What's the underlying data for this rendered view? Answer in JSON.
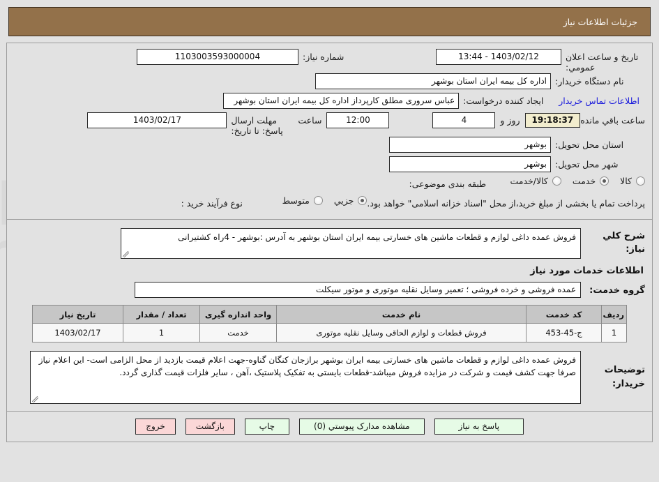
{
  "header": {
    "title": "جزئیات اطلاعات نیاز",
    "bar_color": "#93714a"
  },
  "form": {
    "need_number_label": "شماره نیاز:",
    "need_number_value": "1103003593000004",
    "public_announce_label": "تاریخ و ساعت اعلان عمومي:",
    "public_announce_value": "1403/02/12 - 13:44",
    "buyer_org_label": "نام دستگاه خریدار:",
    "buyer_org_value": "اداره کل بیمه ایران استان بوشهر",
    "creator_label": "ایجاد کننده درخواست:",
    "creator_value": "عباس سروری مطلق کارپرداز اداره کل بیمه ایران استان بوشهر",
    "contact_link": "اطلاعات تماس خریدار",
    "deadline_label": "مهلت ارسال پاسخ: تا تاریخ:",
    "deadline_date": "1403/02/17",
    "deadline_hour_label": "ساعت",
    "deadline_hour": "12:00",
    "days_value": "4",
    "days_word": "روز و",
    "countdown": "19:18:37",
    "remaining_word": "ساعت باقي مانده",
    "province_label": "استان محل تحویل:",
    "province_value": "بوشهر",
    "city_label": "شهر محل تحویل:",
    "city_value": "بوشهر",
    "category_label": "طبقه بندی موضوعی:",
    "category_options": [
      {
        "label": "کالا",
        "selected": false
      },
      {
        "label": "خدمت",
        "selected": true
      },
      {
        "label": "کالا/خدمت",
        "selected": false
      }
    ],
    "process_label": "نوع فرآیند خرید :",
    "process_options": [
      {
        "label": "جزیي",
        "selected": true
      },
      {
        "label": "متوسط",
        "selected": false
      }
    ],
    "payment_note": "پرداخت تمام یا بخشی از مبلغ خرید،از محل \"اسناد خزانه اسلامی\" خواهد بود."
  },
  "detail": {
    "need_desc_label": "شرح کلي نیاز:",
    "need_desc_value": "فروش عمده داغی لوازم و قطعات ماشین های خسارتی بیمه ایران استان بوشهر به  آدرس :بوشهر - 4راه کشتیرانی",
    "services_section_title": "اطلاعات خدمات مورد نیاز",
    "service_group_label": "گروه خدمت:",
    "service_group_value": "عمده فروشی و خرده فروشی ؛ تعمیر وسایل نقلیه موتوری و موتور سیکلت"
  },
  "table": {
    "headers": [
      "ردیف",
      "کد خدمت",
      "نام خدمت",
      "واحد اندازه گیری",
      "تعداد / مقدار",
      "تاریخ نیاز"
    ],
    "rows": [
      {
        "radif": "1",
        "code": "ج-45-453",
        "name": "فروش قطعات و لوازم الحاقی وسایل نقلیه موتوری",
        "unit": "خدمت",
        "qty": "1",
        "date": "1403/02/17"
      }
    ]
  },
  "buyer_notes": {
    "label": "توضیحات خریدار:",
    "value": "فروش عمده داغی لوازم و قطعات ماشین های خسارتی بیمه ایران بوشهر برازجان کنگان گناوه-جهت اعلام قیمت بازدید از محل الزامی است- این اعلام نیاز صرفا جهت کشف قیمت و شرکت در مزایده فروش میباشد-قطعات بایستی به تفکیک پلاستیک ،آهن ، سایر فلزات قیمت گذاری گردد."
  },
  "footer": {
    "buttons": [
      {
        "label": "پاسخ به نیاز",
        "style": "green"
      },
      {
        "label": "مشاهده مدارک پیوستي (0)",
        "style": "green"
      },
      {
        "label": "چاپ",
        "style": "green"
      },
      {
        "label": "بازگشت",
        "style": "pink"
      },
      {
        "label": "خروج",
        "style": "pink"
      }
    ]
  },
  "watermark": {
    "text": "AriaTender.net"
  }
}
